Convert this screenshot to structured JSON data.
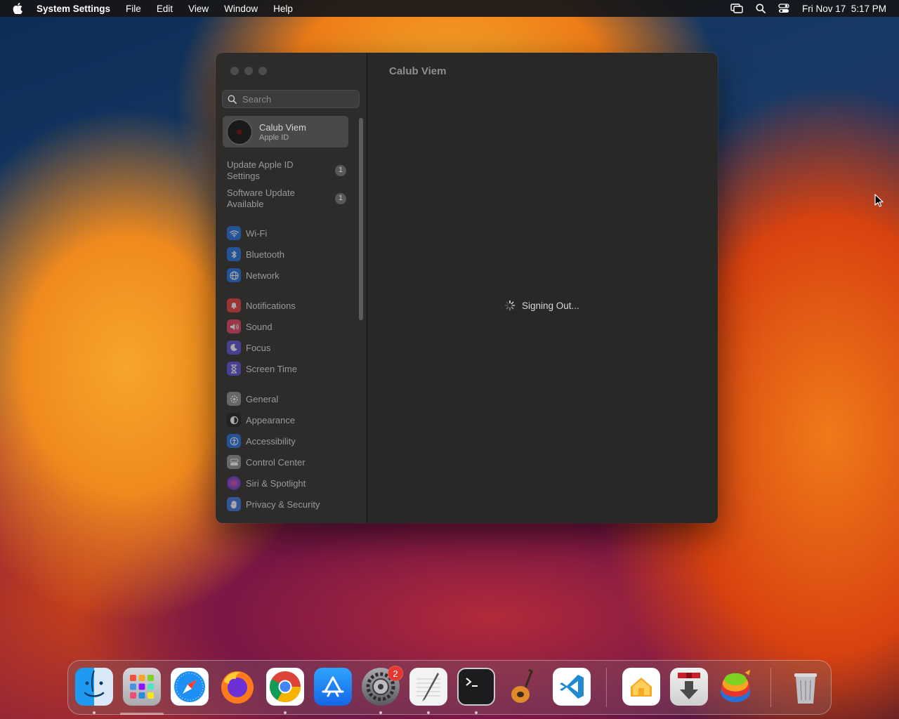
{
  "menubar": {
    "app_name": "System Settings",
    "items": [
      "File",
      "Edit",
      "View",
      "Window",
      "Help"
    ],
    "datetime": "Fri Nov 17  5:17 PM"
  },
  "window": {
    "search_placeholder": "Search",
    "account": {
      "name": "Calub Viem",
      "subtitle": "Apple ID"
    },
    "notices": [
      {
        "label": "Update Apple ID Settings",
        "badge": "1"
      },
      {
        "label": "Software Update Available",
        "badge": "1"
      }
    ],
    "groups": [
      [
        {
          "label": "Wi-Fi",
          "icon": "wifi-icon",
          "color": "#1f6fe0"
        },
        {
          "label": "Bluetooth",
          "icon": "bluetooth-icon",
          "color": "#1f6fe0"
        },
        {
          "label": "Network",
          "icon": "globe-icon",
          "color": "#1f6fe0"
        }
      ],
      [
        {
          "label": "Notifications",
          "icon": "bell-icon",
          "color": "#e53b3b"
        },
        {
          "label": "Sound",
          "icon": "speaker-icon",
          "color": "#e53b5f"
        },
        {
          "label": "Focus",
          "icon": "moon-icon",
          "color": "#5a4fd6"
        },
        {
          "label": "Screen Time",
          "icon": "hourglass-icon",
          "color": "#5a4fd6"
        }
      ],
      [
        {
          "label": "General",
          "icon": "gear-icon",
          "color": "#8e8e93"
        },
        {
          "label": "Appearance",
          "icon": "appearance-icon",
          "color": "#1c1c1e"
        },
        {
          "label": "Accessibility",
          "icon": "accessibility-icon",
          "color": "#1f6fe0"
        },
        {
          "label": "Control Center",
          "icon": "control-center-icon",
          "color": "#8e8e93"
        },
        {
          "label": "Siri & Spotlight",
          "icon": "siri-icon",
          "color": "#6b3ad6"
        },
        {
          "label": "Privacy & Security",
          "icon": "hand-icon",
          "color": "#3a73e0"
        }
      ]
    ],
    "content": {
      "title": "Calub Viem",
      "status": "Signing Out..."
    }
  },
  "dock": {
    "apps": [
      {
        "name": "Finder",
        "icon": "finder-icon",
        "running": true
      },
      {
        "name": "Launchpad",
        "icon": "launchpad-icon",
        "running": false
      },
      {
        "name": "Safari",
        "icon": "safari-icon",
        "running": false
      },
      {
        "name": "Firefox",
        "icon": "firefox-icon",
        "running": false
      },
      {
        "name": "Chrome",
        "icon": "chrome-icon",
        "running": true
      },
      {
        "name": "App Store",
        "icon": "app-store-icon",
        "running": false
      },
      {
        "name": "System Settings",
        "icon": "system-settings-icon",
        "running": true,
        "badge": "2"
      },
      {
        "name": "TextEdit",
        "icon": "textedit-icon",
        "running": true
      },
      {
        "name": "Terminal",
        "icon": "terminal-icon",
        "running": true
      },
      {
        "name": "GarageBand",
        "icon": "garageband-icon",
        "running": false
      },
      {
        "name": "Visual Studio Code",
        "icon": "vscode-icon",
        "running": false
      },
      {
        "name": "Home",
        "icon": "home-icon",
        "running": false
      },
      {
        "name": "Downloader",
        "icon": "download-icon",
        "running": false
      },
      {
        "name": "Toolbox",
        "icon": "toolbox-icon",
        "running": false
      },
      {
        "name": "Trash",
        "icon": "trash-icon",
        "running": false
      }
    ]
  }
}
